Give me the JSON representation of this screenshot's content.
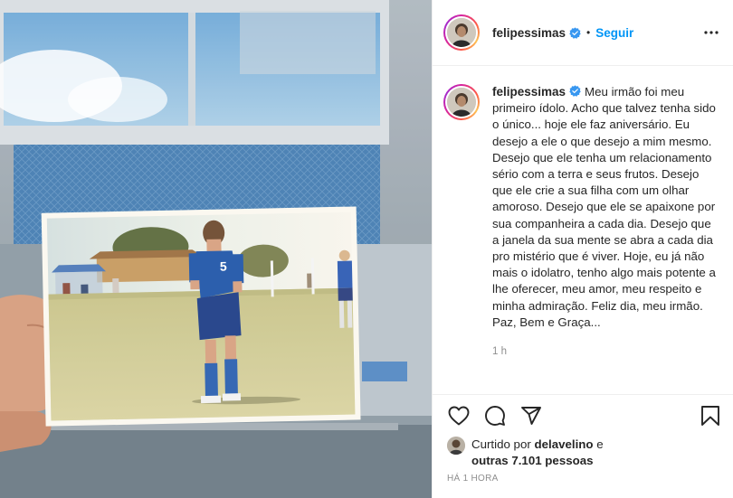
{
  "post": {
    "media": {
      "alt_subject": "handheld-photo-of-soccer-player",
      "jersey_number": "5"
    },
    "header": {
      "username": "felipessimas",
      "separator": "•",
      "follow_label": "Seguir",
      "more_icon": "more-options-icon"
    },
    "caption": {
      "username": "felipessimas",
      "text": "Meu irmão foi meu primeiro ídolo. Acho que talvez tenha sido o único... hoje ele faz aniversário. Eu desejo a ele o que desejo a mim mesmo. Desejo que ele tenha um relacionamento sério com a terra e seus frutos. Desejo que ele crie a sua filha com um olhar amoroso. Desejo que ele se apaixone por sua companheira a cada dia. Desejo que a janela da sua mente se abra a cada dia pro mistério que é viver. Hoje, eu já não mais o idolatro, tenho algo mais potente a lhe oferecer, meu amor, meu respeito e minha admiração. Feliz dia, meu irmão. Paz, Bem e Graça...",
      "time": "1 h"
    },
    "actions": {
      "like_icon": "heart-icon",
      "comment_icon": "comment-icon",
      "share_icon": "share-icon",
      "save_icon": "bookmark-icon"
    },
    "likes": {
      "prefix": "Curtido por ",
      "liker": "delavelino",
      "middle": " e",
      "others": "outras 7.101 pessoas"
    },
    "timestamp": "HÁ 1 HORA",
    "colors": {
      "accent": "#0095f6",
      "verified": "#3897f0",
      "muted": "#8e8e8e",
      "border": "#efefef"
    }
  }
}
